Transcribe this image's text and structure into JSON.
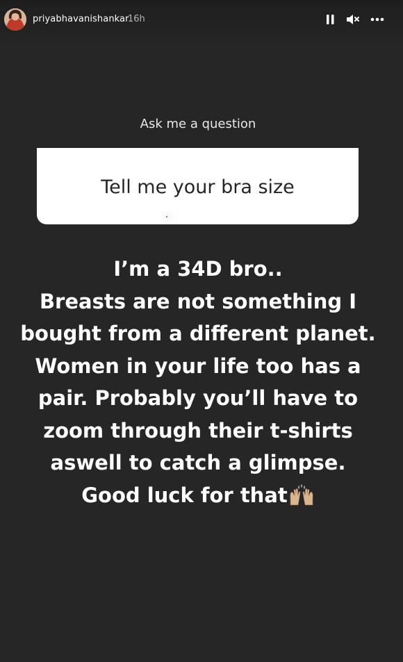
{
  "header": {
    "username": "priyabhavanishankar",
    "timestamp": "16h",
    "avatar_icon": "profile-photo",
    "controls": [
      "pause-icon",
      "mute-icon",
      "more-options-icon"
    ]
  },
  "question_sticker": {
    "prompt": "Ask me a question",
    "answer": "Tell me your bra size"
  },
  "response": {
    "lines": [
      "I’m a 34D bro..",
      "Breasts are not something I",
      "bought from a different planet.",
      "Women in your life too has a",
      "pair. Probably you’ll have to",
      "zoom through their t-shirts",
      "aswell to catch a glimpse.",
      "Good luck for that"
    ],
    "emoji": "raising-hands-emoji"
  },
  "colors": {
    "background": "#262626",
    "text": "#ffffff",
    "sticker_background": "#ffffff",
    "sticker_text": "#262626"
  }
}
